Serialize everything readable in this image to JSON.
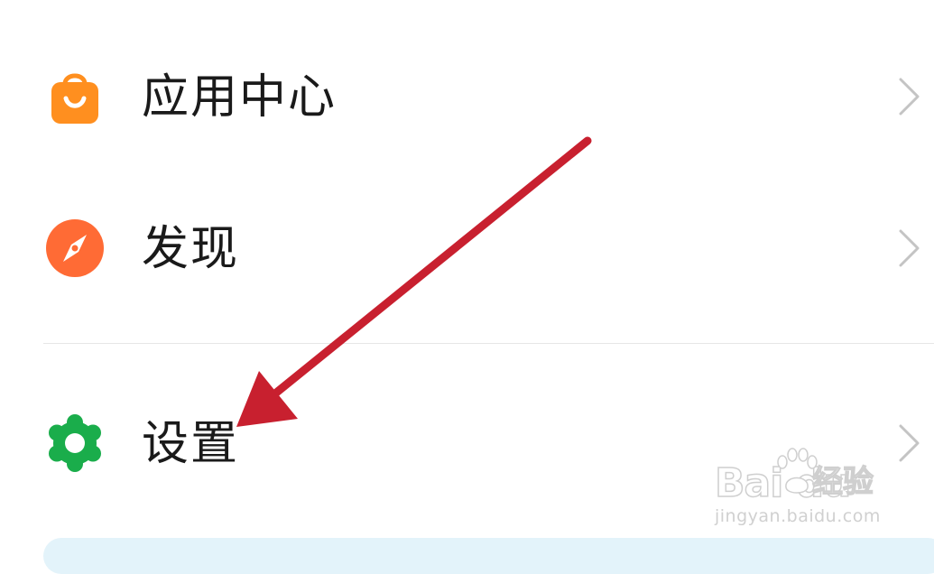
{
  "menu": {
    "items": [
      {
        "label": "应用中心",
        "icon": "shopping-bag-icon",
        "icon_color": "#FF8F1F"
      },
      {
        "label": "发现",
        "icon": "compass-icon",
        "icon_color": "#FF6B35"
      },
      {
        "label": "设置",
        "icon": "gear-icon",
        "icon_color": "#1AAD4B"
      }
    ]
  },
  "annotation": {
    "arrow_color": "#C8202F",
    "points_to": "设置"
  },
  "watermark": {
    "brand_latin": "Bai du",
    "brand_cn": "经验",
    "url": "jingyan.baidu.com"
  }
}
